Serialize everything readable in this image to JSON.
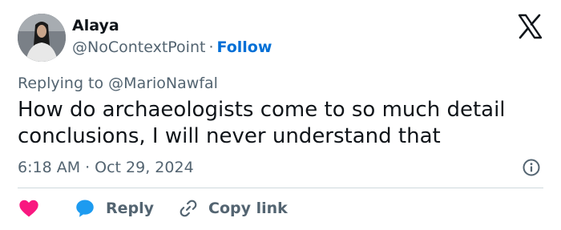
{
  "author": {
    "name": "Alaya",
    "handle": "@NoContextPoint",
    "separator": "·",
    "follow_label": "Follow"
  },
  "reply_context": {
    "prefix": "Replying to",
    "mention": "@MarioNawfal"
  },
  "tweet": {
    "text": "How do archaeologists come to so much detail conclusions, I will never understand that"
  },
  "meta": {
    "time": "6:18 AM",
    "separator": "·",
    "date": "Oct 29, 2024"
  },
  "actions": {
    "reply_label": "Reply",
    "copy_label": "Copy link"
  },
  "icons": {
    "brand": "x-logo-icon",
    "info": "info-icon",
    "like": "heart-icon",
    "reply": "speech-bubble-icon",
    "copy": "link-icon"
  },
  "colors": {
    "text": "#0f1419",
    "secondary": "#536471",
    "follow": "#006fd6",
    "like": "#f91880",
    "reply": "#1d9bf0",
    "divider": "#cfd9de"
  }
}
